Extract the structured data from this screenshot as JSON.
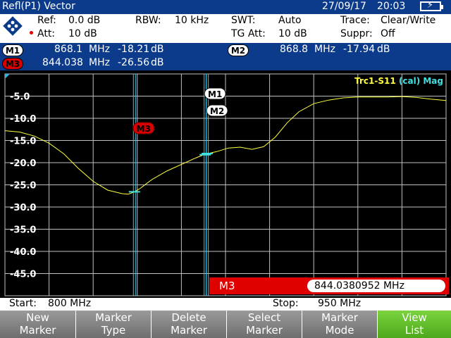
{
  "title_bar": {
    "mode": "Refl(P1) Vector",
    "date": "27/09/17",
    "time": "20:03"
  },
  "settings": {
    "ref_label": "Ref:",
    "ref_value": "0.0 dB",
    "att_label": "Att:",
    "att_value": "10 dB",
    "rbw_label": "RBW:",
    "rbw_value": "10 kHz",
    "swt_label": "SWT:",
    "swt_value": "Auto",
    "tgatt_label": "TG Att:",
    "tgatt_value": "10 dB",
    "trace_label": "Trace:",
    "trace_value": "Clear/Write",
    "suppr_label": "Suppr:",
    "suppr_value": "Off"
  },
  "markers": {
    "m1": {
      "label": "M1",
      "freq": "868.1",
      "unit": "MHz",
      "level": "-18.21",
      "level_unit": "dB"
    },
    "m2": {
      "label": "M2",
      "freq": "868.8",
      "unit": "MHz",
      "level": "-17.94",
      "level_unit": "dB"
    },
    "m3": {
      "label": "M3",
      "freq": "844.038",
      "unit": "MHz",
      "level": "-26.56",
      "level_unit": "dB"
    }
  },
  "chart_data": {
    "type": "line",
    "trace_label": "Trc1-S11",
    "trace_suffix": "(cal)",
    "trace_format": "Mag",
    "y_ticks": [
      "-5.0",
      "-10.0",
      "-15.0",
      "-20.0",
      "-25.0",
      "-30.0",
      "-35.0",
      "-40.0",
      "-45.0"
    ],
    "ylim": [
      -50,
      0
    ],
    "xlim": [
      800,
      950
    ],
    "x_unit": "MHz",
    "grid": true,
    "series": [
      {
        "name": "Trc1-S11",
        "color": "#ffff40",
        "x": [
          800,
          805,
          810,
          815,
          820,
          825,
          830,
          835,
          840,
          842,
          844,
          846,
          848,
          850,
          855,
          860,
          865,
          868,
          872,
          876,
          880,
          884,
          888,
          892,
          896,
          900,
          905,
          910,
          915,
          920,
          925,
          930,
          935,
          940,
          945,
          950
        ],
        "y": [
          -12.8,
          -13.1,
          -14.0,
          -15.6,
          -18.0,
          -21.3,
          -24.2,
          -26.2,
          -27.0,
          -27.1,
          -26.6,
          -25.8,
          -24.8,
          -23.8,
          -21.9,
          -20.4,
          -18.9,
          -18.1,
          -17.5,
          -16.7,
          -16.5,
          -17.0,
          -16.4,
          -14.2,
          -11.0,
          -8.5,
          -6.7,
          -5.9,
          -5.4,
          -5.2,
          -5.2,
          -5.2,
          -5.1,
          -5.3,
          -5.7,
          -6.0
        ]
      }
    ],
    "markers": [
      {
        "label": "M1",
        "x": 868.1,
        "y": -18.21
      },
      {
        "label": "M2",
        "x": 868.8,
        "y": -17.94
      },
      {
        "label": "M3",
        "x": 844.038,
        "y": -26.56
      }
    ]
  },
  "marker_input": {
    "label": "M3",
    "value": "844.0380952 MHz"
  },
  "freq_bar": {
    "start_label": "Start:",
    "start_value": "800 MHz",
    "stop_label": "Stop:",
    "stop_value": "950 MHz"
  },
  "softkeys": [
    {
      "line1": "New",
      "line2": "Marker"
    },
    {
      "line1": "Marker",
      "line2": "Type"
    },
    {
      "line1": "Delete",
      "line2": "Marker"
    },
    {
      "line1": "Select",
      "line2": "Marker"
    },
    {
      "line1": "Marker",
      "line2": "Mode"
    },
    {
      "line1": "View",
      "line2": "List"
    }
  ]
}
